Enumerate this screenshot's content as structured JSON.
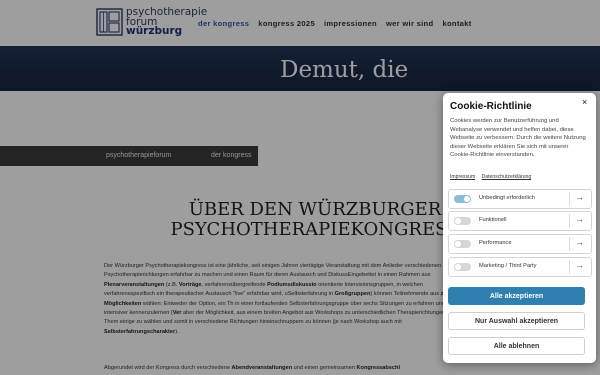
{
  "logo": {
    "line1": "psychotherapie",
    "line2": "forum",
    "line3": "würzburg"
  },
  "nav": [
    {
      "label": "der kongress",
      "active": true
    },
    {
      "label": "kongress 2025",
      "active": false
    },
    {
      "label": "impressionen",
      "active": false
    },
    {
      "label": "wer wir sind",
      "active": false
    },
    {
      "label": "kontakt",
      "active": false
    }
  ],
  "hero": {
    "title": "Demut, die"
  },
  "breadcrumb": {
    "item1": "psychotherapieforum",
    "item2": "der kongress"
  },
  "main": {
    "heading_line1": "ÜBER DEN WÜRZBURGER",
    "heading_line2": "PSYCHOTHERAPIEKONGRESS",
    "p1": [
      {
        "t": "Der Würzburger Psychotherapiekongress ist eine jährliche, seit einigen Jahren viertägige Veranstaltung mit dem Anlie"
      },
      {
        "t": "der verschiedenen Psychotherapierichtungen erfahrbar zu machen und einen Raum für deren Austausch und Diskuss"
      },
      {
        "t": "Eingebettet in einen Rahmen aus "
      },
      {
        "t": "Plenarveranstaltungen",
        "b": true
      },
      {
        "t": " (z.B. "
      },
      {
        "t": "Vorträge",
        "b": true
      },
      {
        "t": ", verfahrensübergreifende "
      },
      {
        "t": "Podiumsdiskussio",
        "b": true
      },
      {
        "t": " orientierte Intervisionsgruppen, in welchen verfahrensspezifisch ein therapeutischer Austausch \"live\" erfahrbar wird, u"
      },
      {
        "t": "Selbsterfahrung in "
      },
      {
        "t": "Großgruppen",
        "b": true
      },
      {
        "t": ") können Teilnehmende aus "
      },
      {
        "t": "zwei Möglichkeiten",
        "b": true
      },
      {
        "t": " wählen: Entweder der Option, ein Th"
      },
      {
        "t": " in einer fortlaufenden Selbsterfahrungsgruppe über sechs Sitzungen zu erfahren und intensiver kennenzulernen ("
      },
      {
        "t": "Ver",
        "b": true
      },
      {
        "t": " aber der Möglichkeit, aus einem breiten Angebot aus Workshops zu unterschiedlichen Therapierichtungen und Them"
      },
      {
        "t": " einige zu wählen und somit in verschiedene Richtungen hineinschnuppern zu können (je nach Workshop auch mit"
      },
      {
        "t": " "
      },
      {
        "t": "Selbsterfahrungscharakter",
        "b": true
      },
      {
        "t": ")."
      }
    ],
    "p2": [
      {
        "t": "Abgerundet wird der Kongress durch verschiedene "
      },
      {
        "t": "Abendveranstaltungen",
        "b": true
      },
      {
        "t": " und einen gemeinsamen "
      },
      {
        "t": "Kongressabschl",
        "b": true
      }
    ]
  },
  "cookie": {
    "title": "Cookie-Richtlinie",
    "close": "×",
    "description": "Cookies werden zur Benutzerführung und Webanalyse verwendet und helfen dabei, diese Webseite zu verbessern. Durch die weitere Nutzung dieser Webseite erklären Sie sich mit unserer Cookie-Richtlinie einverstanden.",
    "link_impressum": "Impressum",
    "link_privacy": "Datenschutzerklärung",
    "categories": [
      {
        "label": "Unbedingt erforderlich",
        "on": true
      },
      {
        "label": "Funktionell",
        "on": false
      },
      {
        "label": "Performance",
        "on": false
      },
      {
        "label": "Marketing / Third Party",
        "on": false
      }
    ],
    "arrow": "→",
    "btn_accept_all": "Alle akzeptieren",
    "btn_accept_selection": "Nur Auswahl akzeptieren",
    "btn_reject_all": "Alle ablehnen"
  }
}
